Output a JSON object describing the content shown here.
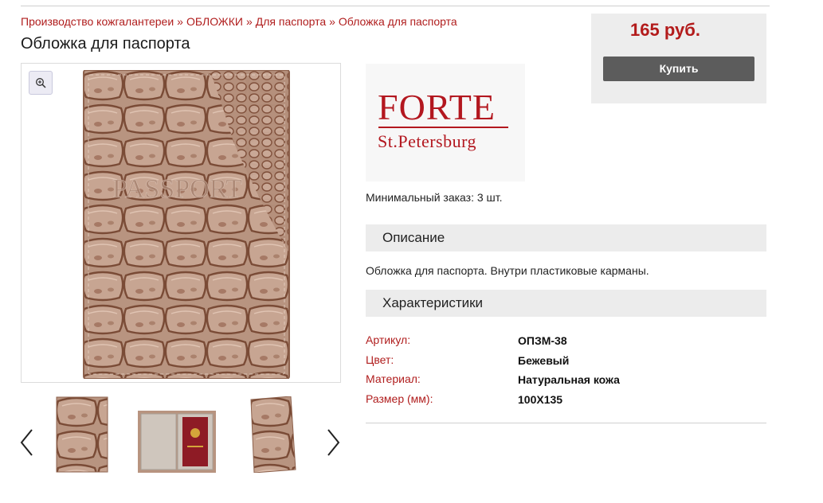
{
  "breadcrumb": {
    "items": [
      "Производство кожгалантереи",
      "ОБЛОЖКИ",
      "Для паспорта",
      "Обложка для паспорта"
    ],
    "separator": "»"
  },
  "page_title": "Обложка для паспорта",
  "product": {
    "price": "165 руб.",
    "buy_label": "Купить",
    "brand_logo": {
      "name": "FORTE",
      "city": "St.Petersburg"
    },
    "embossed_text": "PASSPORT",
    "min_order": "Минимальный заказ: 3 шт.",
    "description_title": "Описание",
    "description": "Обложка для паспорта. Внутри пластиковые карманы.",
    "specs_title": "Характеристики",
    "specs": [
      {
        "label": "Артикул:",
        "value": "ОПЗМ-38"
      },
      {
        "label": "Цвет:",
        "value": "Бежевый"
      },
      {
        "label": "Материал:",
        "value": "Натуральная кожа"
      },
      {
        "label": "Размер (мм):",
        "value": "100Х135"
      }
    ]
  },
  "gallery": {
    "zoom_icon": "zoom-in-icon",
    "prev_icon": "chevron-left-icon",
    "next_icon": "chevron-right-icon",
    "thumbnail_count": 3
  },
  "colors": {
    "accent_red": "#b01d1d",
    "logo_red": "#b3171f",
    "leather": "#b58f7b",
    "button_gray": "#5c5c5c",
    "panel_gray": "#ededed"
  }
}
